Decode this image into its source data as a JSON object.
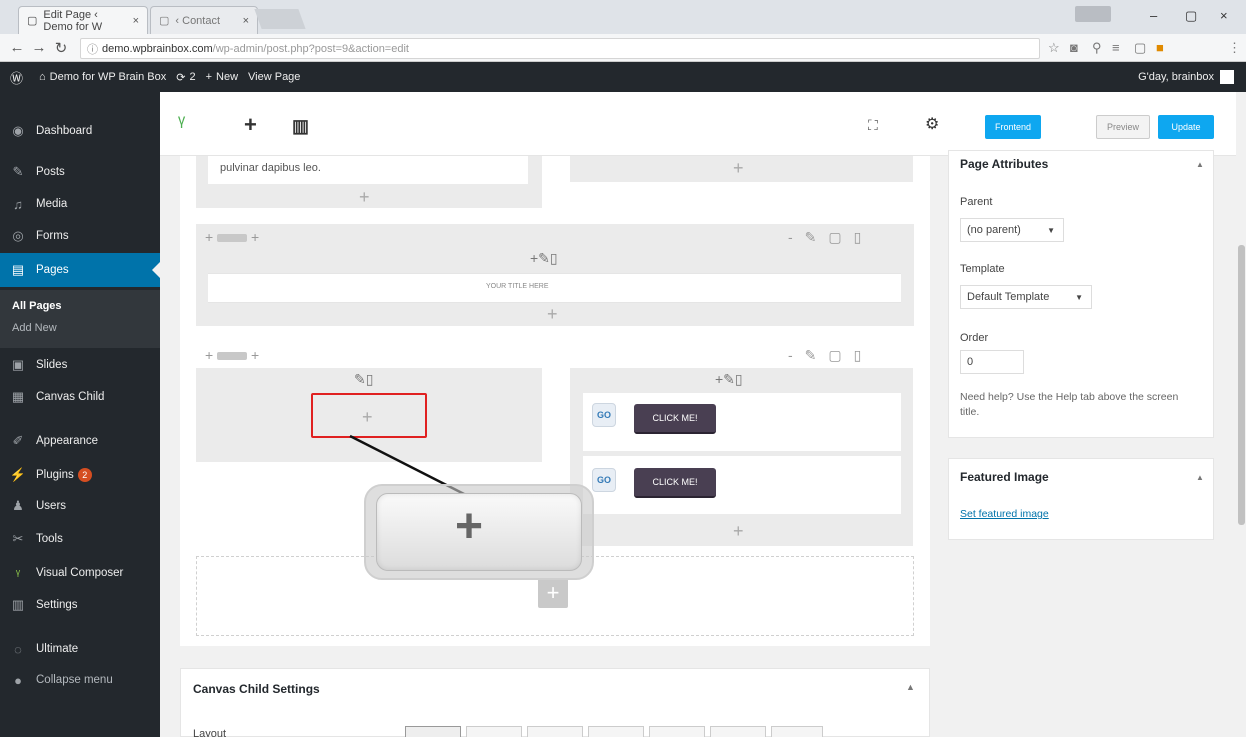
{
  "browser": {
    "tabs": [
      {
        "label": "Edit Page ‹ Demo for W",
        "close": "×"
      },
      {
        "label": "‹ Contact",
        "close": "×"
      }
    ],
    "url_host": "demo.wpbrainbox.com",
    "url_path": "/wp-admin/post.php?post=9&action=edit",
    "window_controls": [
      "–",
      "▢",
      "×"
    ]
  },
  "adminbar": {
    "site": "Demo for WP Brain Box",
    "updates": "2",
    "new": "New",
    "view": "View Page",
    "greeting": "G'day, brainbox"
  },
  "sidebar": {
    "items": [
      {
        "label": "Dashboard",
        "icon": "dashboard-icon"
      },
      {
        "label": "Posts",
        "icon": "pin-icon"
      },
      {
        "label": "Media",
        "icon": "media-icon"
      },
      {
        "label": "Forms",
        "icon": "forms-icon"
      },
      {
        "label": "Pages",
        "icon": "pages-icon"
      },
      {
        "label": "Slides",
        "icon": "slides-icon"
      },
      {
        "label": "Canvas Child",
        "icon": "canvas-icon"
      },
      {
        "label": "Appearance",
        "icon": "brush-icon"
      },
      {
        "label": "Plugins",
        "icon": "plug-icon",
        "badge": "2"
      },
      {
        "label": "Users",
        "icon": "users-icon"
      },
      {
        "label": "Tools",
        "icon": "wrench-icon"
      },
      {
        "label": "Visual Composer",
        "icon": "vc-icon"
      },
      {
        "label": "Settings",
        "icon": "settings-icon"
      },
      {
        "label": "Ultimate",
        "icon": "ultimate-icon"
      },
      {
        "label": "Collapse menu",
        "icon": "collapse-icon"
      }
    ],
    "submenu": [
      "All Pages",
      "Add New"
    ]
  },
  "toolbar": {
    "frontend": "Frontend",
    "preview": "Preview",
    "update": "Update"
  },
  "content": {
    "text_snippet": "pulvinar dapibus leo.",
    "title_placeholder": "YOUR TITLE HERE",
    "go_label": "GO",
    "click_label": "CLICK ME!",
    "plus": "+"
  },
  "page_attributes": {
    "title": "Page Attributes",
    "parent_label": "Parent",
    "parent_value": "(no parent)",
    "template_label": "Template",
    "template_value": "Default Template",
    "order_label": "Order",
    "order_value": "0",
    "help": "Need help? Use the Help tab above the screen title."
  },
  "featured_image": {
    "title": "Featured Image",
    "link": "Set featured image"
  },
  "canvas_settings": {
    "title": "Canvas Child Settings",
    "layout_label": "Layout"
  }
}
